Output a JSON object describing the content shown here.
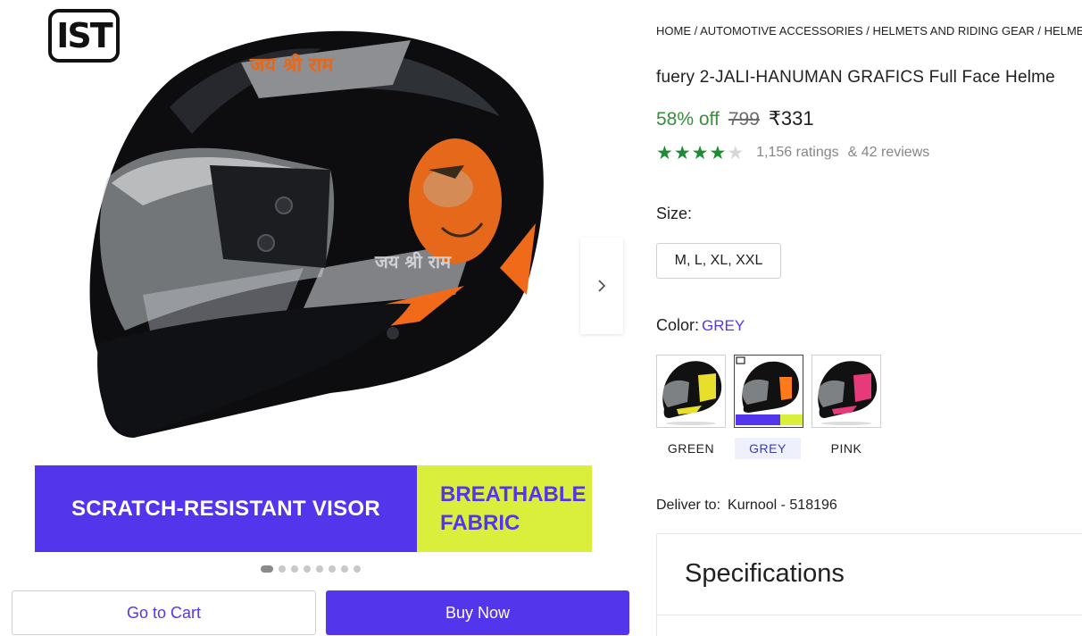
{
  "gallery": {
    "ist_logo_text": "IST",
    "helmet_text_1": "जय श्री राम",
    "helmet_text_2": "जय श्री राम",
    "banner_left": "SCRATCH-RESISTANT VISOR",
    "banner_right_line1": "BREATHABLE",
    "banner_right_line2": "FABRIC",
    "next_icon": "chevron-right-icon",
    "dot_count": 8,
    "active_dot": 0
  },
  "actions": {
    "cart_label": "Go to Cart",
    "buy_label": "Buy Now"
  },
  "breadcrumb": [
    "HOME",
    "AUTOMOTIVE ACCESSORIES",
    "HELMETS AND RIDING GEAR",
    "HELMET A"
  ],
  "product": {
    "title": "fuery 2-JALI-HANUMAN GRAFICS Full Face Helme",
    "discount": "58% off",
    "mrp": "799",
    "price": "₹331",
    "rating_stars": 4,
    "ratings_text": "1,156 ratings",
    "reviews_text": "& 42 reviews"
  },
  "size": {
    "label": "Size:",
    "options": [
      "M, L, XL, XXL"
    ]
  },
  "color": {
    "label": "Color:",
    "selected": "GREY",
    "options": [
      {
        "name": "GREEN",
        "accent": "#e8df2c"
      },
      {
        "name": "GREY",
        "accent": "#ff7a1a"
      },
      {
        "name": "PINK",
        "accent": "#e83a7a"
      }
    ]
  },
  "delivery": {
    "label": "Deliver to:",
    "location": "Kurnool - 518196"
  },
  "specs": {
    "title": "Specifications"
  },
  "colors": {
    "brand": "#5336ec",
    "banner_accent": "#d9ef3c",
    "discount_green": "#388e3c",
    "star_green": "#1d8c35"
  }
}
